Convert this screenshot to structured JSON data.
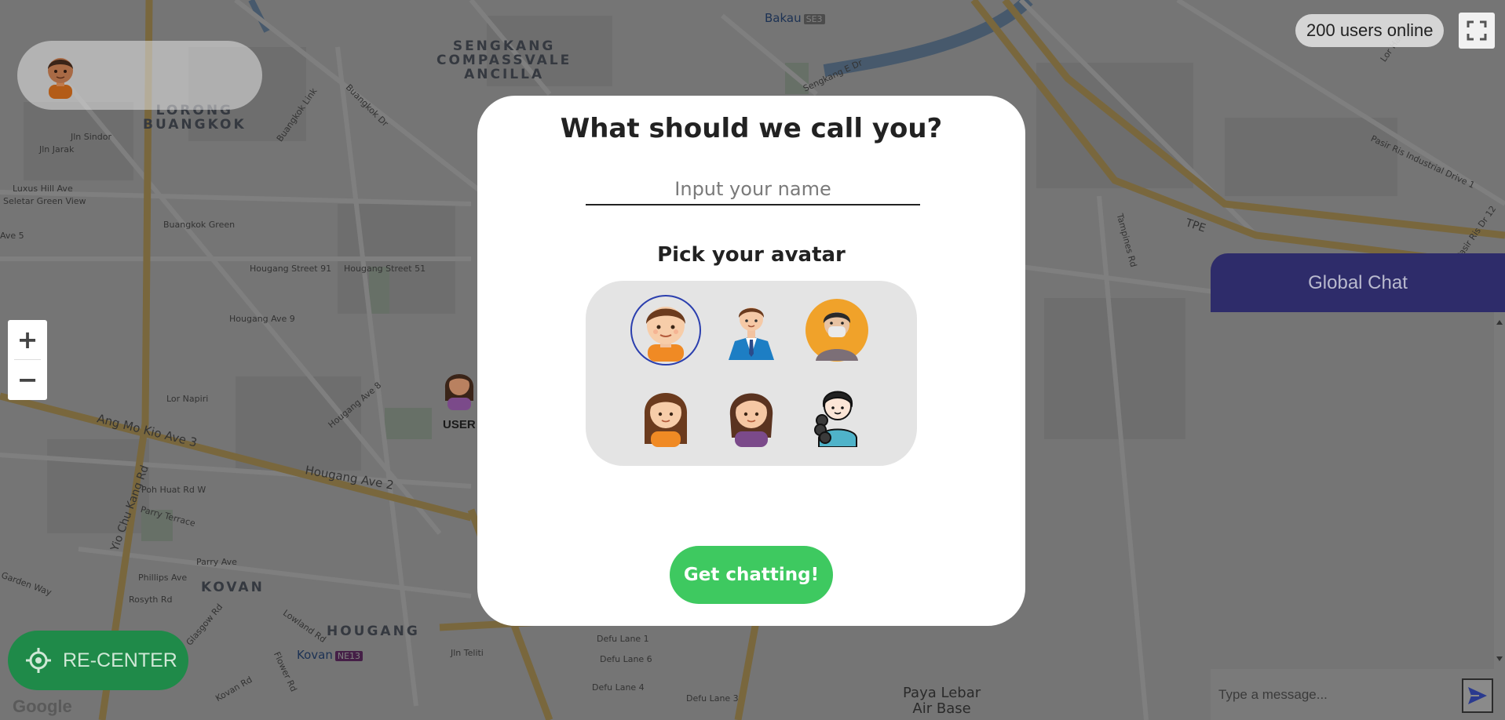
{
  "map": {
    "areas": [
      {
        "id": "sengkang",
        "text": "SENGKANG\nCOMPASSVALE\nANCILLA"
      },
      {
        "id": "buangkok",
        "text": "LORONG\nBUANGKOK"
      },
      {
        "id": "kovan",
        "text": "KOVAN"
      },
      {
        "id": "hougang",
        "text": "HOUGANG"
      }
    ],
    "roads": [
      "Buangkok Link",
      "Buangkok Dr",
      "Buangkok Green",
      "Hougang Street 91",
      "Hougang Street 51",
      "Hougang Ave 9",
      "Hougang Ave 8",
      "Hougang Ave 2",
      "Ang Mo Kio Ave 3",
      "Yio Chu Kang Rd",
      "Poh Huat Rd W",
      "Parry Terrace",
      "Parry Ave",
      "Phillips Ave",
      "Rosyth Rd",
      "Glasgow Rd",
      "Lowland Rd",
      "Flower Rd",
      "Kovan Rd",
      "Defu Lane 1",
      "Defu Lane 6",
      "Defu Lane 4",
      "Defu Lane 3",
      "Jln Teliti",
      "Tampines Rd",
      "TPE",
      "Sengkang E Dr",
      "Pasir Ris Industrial Drive 1",
      "Pasir Ris Dr 12",
      "Lor Halus",
      "Seletar Green View",
      "Luxus Hill Ave",
      "Jln Sindor",
      "Jln Jarak",
      "Lor Napiri",
      "Ave 5",
      "Garden Way"
    ],
    "stations": [
      {
        "name": "Bakau",
        "code": "SE3"
      },
      {
        "name": "Kovan",
        "code": "NE13"
      }
    ],
    "airbase": "Paya Lebar\nAir Base",
    "google_mark": "Google"
  },
  "user_marker": {
    "label": "USER"
  },
  "top_left_card": {
    "avatar": "boy-avatar"
  },
  "zoom": {
    "in": "+",
    "out": "−"
  },
  "recenter": {
    "label": "RE-CENTER",
    "icon": "crosshair-icon"
  },
  "online": {
    "text": "200 users online"
  },
  "fullscreen": {
    "icon": "fullscreen-icon"
  },
  "chat": {
    "title": "Global Chat",
    "input_placeholder": "Type a message...",
    "send_icon": "send-icon"
  },
  "modal": {
    "title": "What should we call you?",
    "name_placeholder": "Input your name",
    "avatar_title": "Pick your avatar",
    "avatars": [
      {
        "name": "boy-avatar",
        "selected": true
      },
      {
        "name": "businessman-avatar",
        "selected": false
      },
      {
        "name": "masked-man-avatar",
        "selected": false
      },
      {
        "name": "girl-avatar",
        "selected": false
      },
      {
        "name": "woman-avatar",
        "selected": false
      },
      {
        "name": "curly-hair-woman-avatar",
        "selected": false
      }
    ],
    "cta": "Get chatting!"
  },
  "colors": {
    "chat_header": "#2e2c6a",
    "cta": "#3ec960",
    "recenter": "#1f8a49",
    "selected_ring": "#2b3fae"
  }
}
